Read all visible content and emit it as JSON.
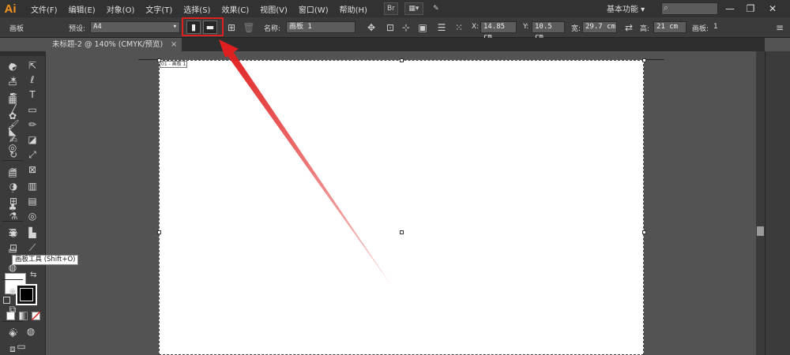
{
  "app": {
    "logo": "Ai"
  },
  "menu": [
    "文件(F)",
    "编辑(E)",
    "对象(O)",
    "文字(T)",
    "选择(S)",
    "效果(C)",
    "视图(V)",
    "窗口(W)",
    "帮助(H)"
  ],
  "menubar_buttons": {
    "bridge": "Br"
  },
  "workspace": "基本功能",
  "window_controls": {
    "minimize": "—",
    "restore": "❐",
    "close": "✕"
  },
  "control_bar": {
    "panel_name": "画板",
    "preset_label": "预设:",
    "preset_value": "A4",
    "name_label": "名称:",
    "name_value": "画板 1",
    "x_label": "X:",
    "x_value": "14.85 cm",
    "y_label": "Y:",
    "y_value": "10.5 cm",
    "w_label": "宽:",
    "w_value": "29.7 cm",
    "h_label": "高:",
    "h_value": "21 cm",
    "artboards_label": "画板:",
    "artboards_value": "1"
  },
  "document": {
    "tab_title": "未标题-2 @ 140% (CMYK/预览)",
    "close": "×"
  },
  "artboard": {
    "label": "01 - 画板 1"
  },
  "tooltip": "画板工具 (Shift+O)",
  "colors": {
    "annotation_red": "#e02020",
    "accent_logo": "#f7941d",
    "ui_dark": "#323232",
    "canvas": "#535353"
  }
}
